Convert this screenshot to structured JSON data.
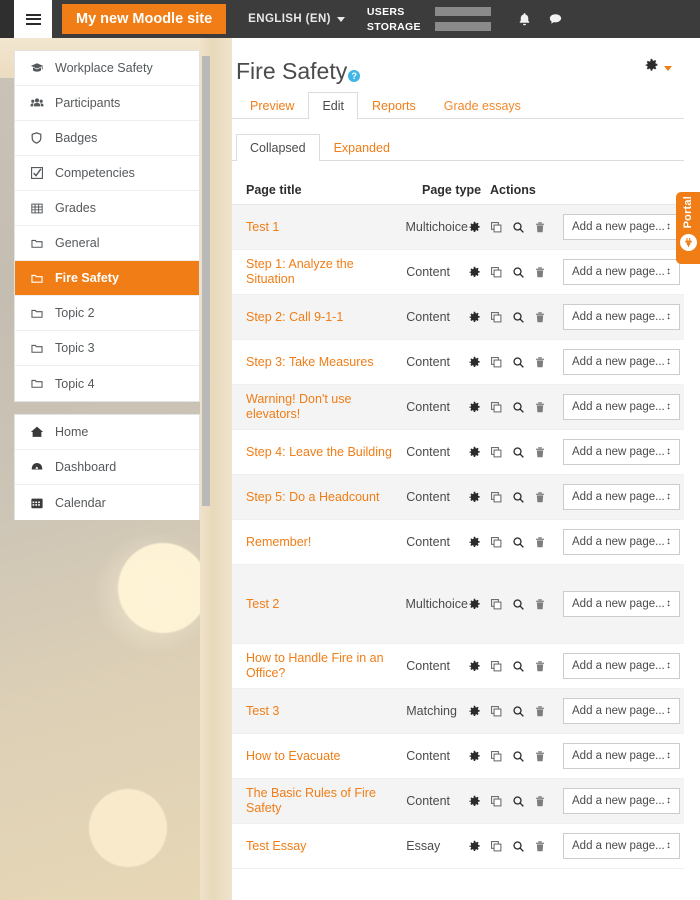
{
  "navbar": {
    "menu_icon": "hamburger-icon",
    "site_name": "My new Moodle site",
    "language": "ENGLISH (EN)",
    "meters": [
      {
        "label": "USERS",
        "icon": "progress-bar"
      },
      {
        "label": "STORAGE",
        "icon": "progress-bar"
      }
    ],
    "notifications_icon": "bell-icon",
    "messages_icon": "speech-bubble-icon"
  },
  "sidebar": {
    "blocks": [
      {
        "items": [
          {
            "label": "Workplace Safety",
            "icon": "graduation-cap-icon",
            "active": false
          },
          {
            "label": "Participants",
            "icon": "users-icon",
            "active": false
          },
          {
            "label": "Badges",
            "icon": "shield-icon",
            "active": false
          },
          {
            "label": "Competencies",
            "icon": "check-square-icon",
            "active": false
          },
          {
            "label": "Grades",
            "icon": "table-icon",
            "active": false
          },
          {
            "label": "General",
            "icon": "folder-icon",
            "active": false
          },
          {
            "label": "Fire Safety",
            "icon": "folder-icon",
            "active": true
          },
          {
            "label": "Topic 2",
            "icon": "folder-icon",
            "active": false
          },
          {
            "label": "Topic 3",
            "icon": "folder-icon",
            "active": false
          },
          {
            "label": "Topic 4",
            "icon": "folder-icon",
            "active": false
          }
        ]
      },
      {
        "items": [
          {
            "label": "Home",
            "icon": "home-icon",
            "active": false
          },
          {
            "label": "Dashboard",
            "icon": "dashboard-icon",
            "active": false
          },
          {
            "label": "Calendar",
            "icon": "calendar-icon",
            "active": false
          }
        ]
      }
    ]
  },
  "main": {
    "title": "Fire Safety",
    "help_icon_text": "?",
    "gear_icon": "gear-icon",
    "tabs": [
      {
        "label": "Preview",
        "active": false
      },
      {
        "label": "Edit",
        "active": true
      },
      {
        "label": "Reports",
        "active": false
      },
      {
        "label": "Grade essays",
        "active": false
      }
    ],
    "subtabs": [
      {
        "label": "Collapsed",
        "active": true
      },
      {
        "label": "Expanded",
        "active": false
      }
    ],
    "table": {
      "headers": {
        "title": "Page title",
        "type": "Page type",
        "actions": "Actions"
      },
      "action_icons": [
        "gear-icon",
        "copy-icon",
        "magnifier-icon",
        "trash-icon"
      ],
      "add_select_label": "Add a new page...",
      "rows": [
        {
          "title": "Test 1",
          "type": "Multichoice",
          "tall": false
        },
        {
          "title": "Step 1: Analyze the Situation",
          "type": "Content",
          "tall": false
        },
        {
          "title": "Step 2: Call 9-1-1",
          "type": "Content",
          "tall": false
        },
        {
          "title": "Step 3: Take Measures",
          "type": "Content",
          "tall": false
        },
        {
          "title": "Warning! Don't use elevators!",
          "type": "Content",
          "tall": false
        },
        {
          "title": "Step 4: Leave the Building",
          "type": "Content",
          "tall": false
        },
        {
          "title": "Step 5: Do a Headcount",
          "type": "Content",
          "tall": false
        },
        {
          "title": "Remember!",
          "type": "Content",
          "tall": false
        },
        {
          "title": "Test 2",
          "type": "Multichoice",
          "tall": true
        },
        {
          "title": "How to Handle Fire in an Office?",
          "type": "Content",
          "tall": false
        },
        {
          "title": "Test 3",
          "type": "Matching",
          "tall": false
        },
        {
          "title": "How to Evacuate",
          "type": "Content",
          "tall": false
        },
        {
          "title": "The Basic Rules of Fire Safety",
          "type": "Content",
          "tall": false
        },
        {
          "title": "Test Essay",
          "type": "Essay",
          "tall": false
        }
      ]
    }
  },
  "portal": {
    "label": "Portal",
    "icon": "plug-icon"
  },
  "colors": {
    "brand_orange": "#f07d16",
    "navbar_dark": "#3c3c3c",
    "row_alt": "#f4f4f4",
    "help_blue": "#41b6e6"
  }
}
